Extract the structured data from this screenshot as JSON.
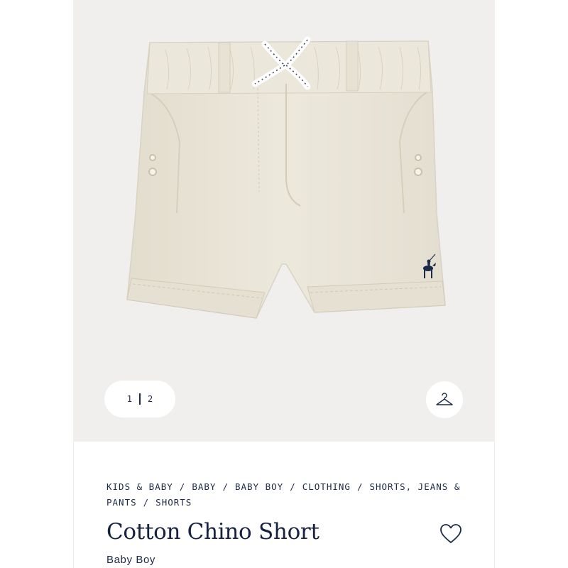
{
  "gallery": {
    "current_index": "1",
    "total": "2"
  },
  "breadcrumb": {
    "items": [
      "KIDS & BABY",
      "BABY",
      "BABY BOY",
      "CLOTHING",
      "SHORTS, JEANS & PANTS",
      "SHORTS"
    ]
  },
  "product": {
    "title": "Cotton Chino Short",
    "subtitle": "Baby Boy"
  },
  "icons": {
    "hanger": "hanger-icon",
    "wishlist": "heart-icon",
    "logo": "polo-player-logo"
  },
  "colors": {
    "navy": "#1b2a47",
    "khaki": "#e9e4d6",
    "hero_bg": "#f0efee"
  }
}
